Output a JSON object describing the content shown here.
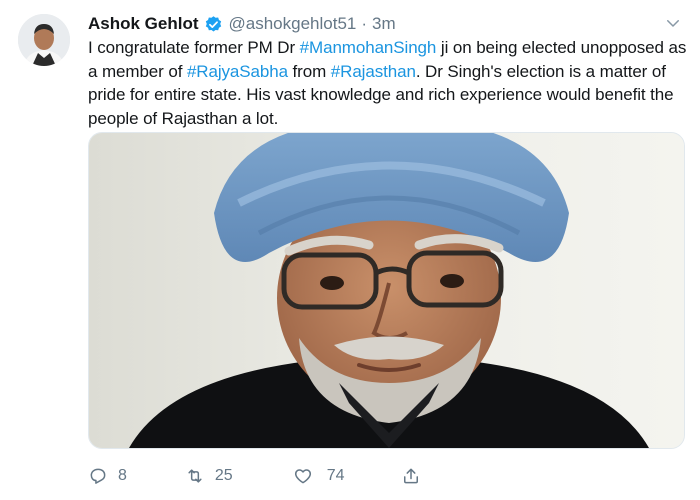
{
  "tweet": {
    "author_name": "Ashok Gehlot",
    "handle": "@ashokgehlot51",
    "separator": "·",
    "time": "3m",
    "text_parts": [
      {
        "t": "I congratulate former PM Dr ",
        "tag": false
      },
      {
        "t": "#ManmohanSingh",
        "tag": true
      },
      {
        "t": " ji on being elected unopposed as a member of ",
        "tag": false
      },
      {
        "t": "#RajyaSabha",
        "tag": true
      },
      {
        "t": " from ",
        "tag": false
      },
      {
        "t": "#Rajasthan",
        "tag": true
      },
      {
        "t": ". Dr Singh's election is a matter of pride for entire state. His vast knowledge and rich experience would benefit the people of Rajasthan a lot.",
        "tag": false
      }
    ],
    "counts": {
      "replies": "8",
      "retweets": "25",
      "likes": "74"
    }
  },
  "icons": {
    "verified": "verified-badge-icon",
    "caret": "chevron-down-icon",
    "reply": "reply-icon",
    "retweet": "retweet-icon",
    "like": "heart-icon",
    "share": "share-icon"
  },
  "colors": {
    "accent": "#1b95e0",
    "text": "#14171a",
    "muted": "#657786",
    "verified": "#1da1f2"
  }
}
